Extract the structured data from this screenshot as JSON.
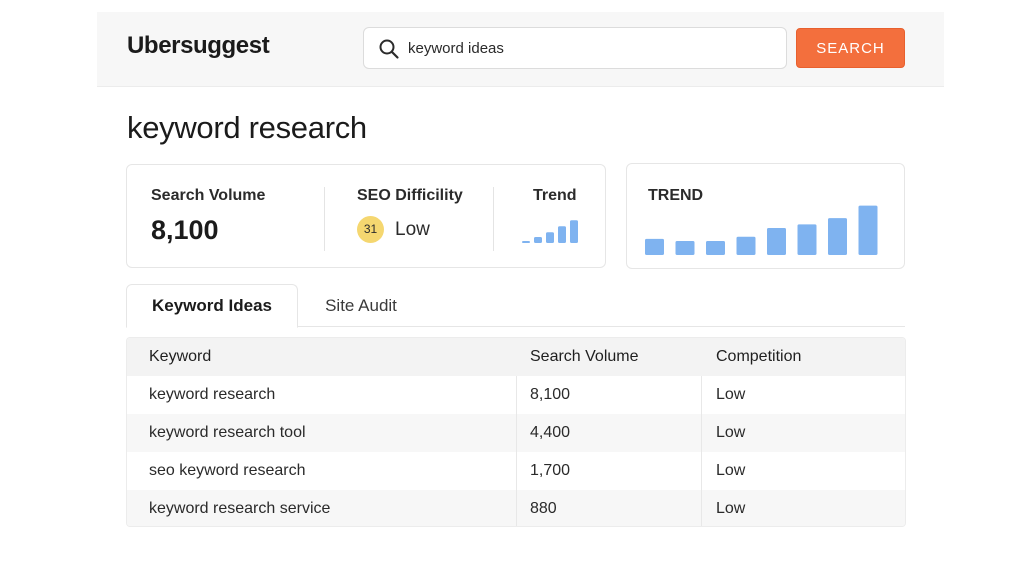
{
  "header": {
    "logo": "Ubersuggest",
    "search": {
      "value": "keyword ideas",
      "placeholder": ""
    },
    "search_button": "SEARCH"
  },
  "page": {
    "title": "keyword research"
  },
  "metrics": {
    "search_volume": {
      "label": "Search Volume",
      "value": "8,100"
    },
    "seo_difficulty": {
      "label": "SEO Difficility",
      "score": "31",
      "level": "Low",
      "badge_color": "#f5d770"
    },
    "trend": {
      "label": "Trend",
      "bars": [
        0.08,
        0.25,
        0.45,
        0.7,
        0.95
      ]
    }
  },
  "trend_card": {
    "title": "TREND",
    "bar_color": "#7fb3f0",
    "bars": [
      0.31,
      0.27,
      0.27,
      0.35,
      0.52,
      0.59,
      0.71,
      0.95
    ]
  },
  "tabs": [
    {
      "label": "Keyword Ideas",
      "active": true
    },
    {
      "label": "Site Audit",
      "active": false
    }
  ],
  "table": {
    "headers": [
      "Keyword",
      "Search Volume",
      "Competition"
    ],
    "rows": [
      [
        "keyword research",
        "8,100",
        "Low"
      ],
      [
        "keyword research tool",
        "4,400",
        "Low"
      ],
      [
        "seo keyword research",
        "1,700",
        "Low"
      ],
      [
        "keyword research service",
        "880",
        "Low"
      ]
    ]
  },
  "colors": {
    "accent": "#f36f3d",
    "bar": "#7fb3f0"
  }
}
